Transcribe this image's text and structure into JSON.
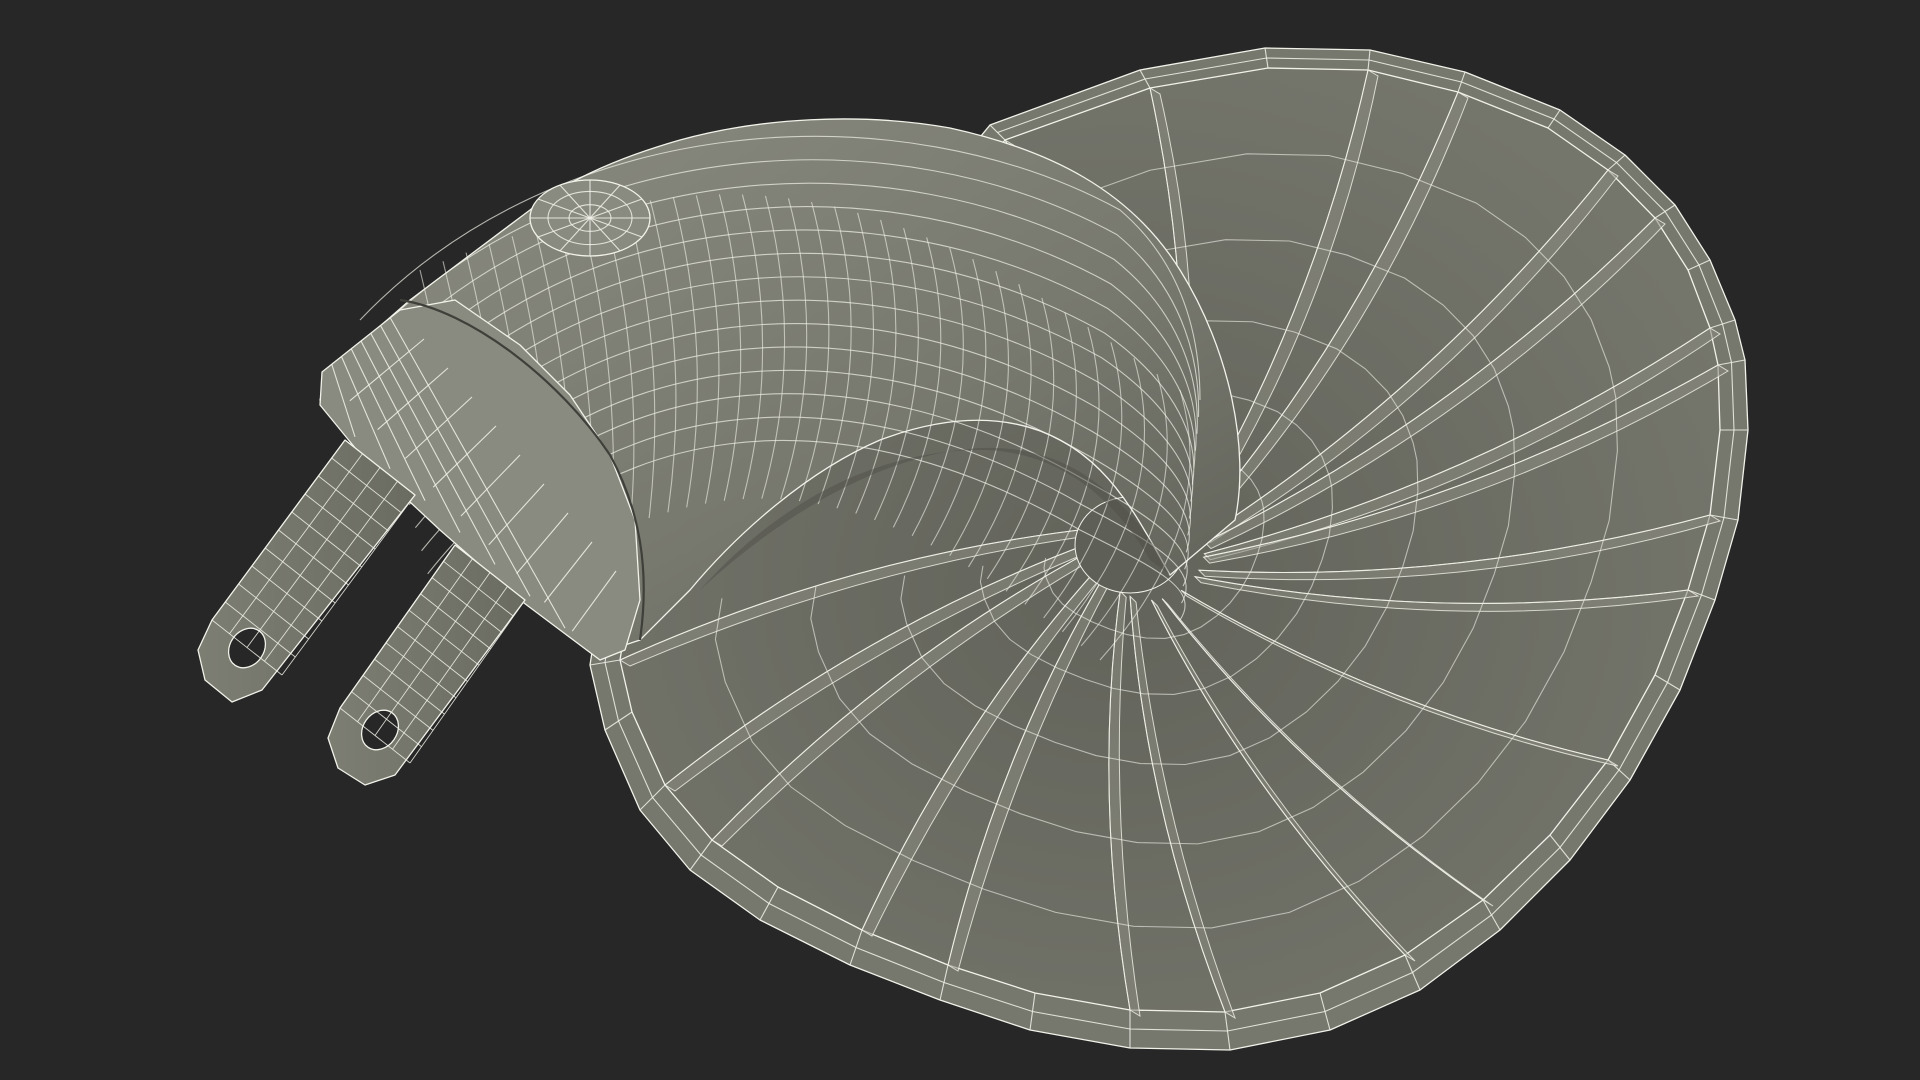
{
  "scene": {
    "subject": "wireframe-3d-model",
    "background_color": "#272727",
    "surface_color": "#76776d",
    "surface_light": "#8a8b80",
    "surface_dark": "#5e5f56",
    "inner_color": "#6b6c62",
    "wire_color": "#f2f2ea",
    "shadow_color": "#4f5049"
  }
}
